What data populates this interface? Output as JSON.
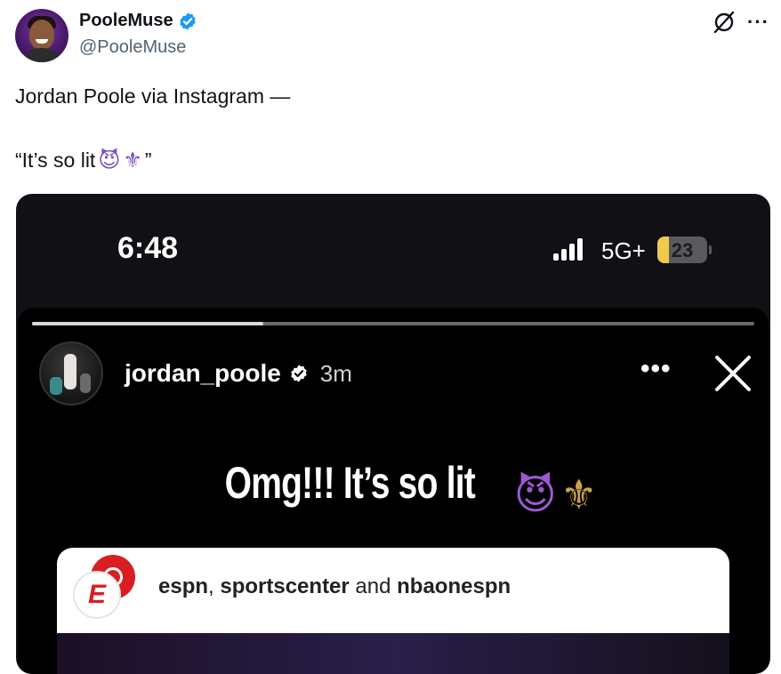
{
  "tweet": {
    "display_name": "PooleMuse",
    "handle": "@PooleMuse",
    "text_line1": "Jordan Poole via Instagram —",
    "text_line2": "“It’s so lit",
    "text_line2_close": "”",
    "emoji_devil": "😈",
    "emoji_fleur": "⚜"
  },
  "status_bar": {
    "time": "6:48",
    "network": "5G+",
    "battery_percent": "23",
    "battery_level": 0.23
  },
  "story": {
    "progress": 0.32,
    "username": "jordan_poole",
    "time_ago": "3m",
    "more_glyph": "•••",
    "caption": "Omg!!! It’s so lit",
    "caption_emoji_devil": "😈",
    "caption_emoji_fleur": "⚜"
  },
  "share_card": {
    "logo_letter": "E",
    "account1": "espn",
    "separator": ", ",
    "account2": "sportscenter",
    "conjunction": " and ",
    "account3": "nbaonespn"
  },
  "colors": {
    "verified_blue": "#1d9bf0",
    "espn_red": "#d81e22",
    "battery_yellow": "#f2c94c"
  },
  "icons": {
    "verified": "verified-badge-icon",
    "grok": "grok-icon",
    "more": "more-icon",
    "close": "close-icon"
  }
}
